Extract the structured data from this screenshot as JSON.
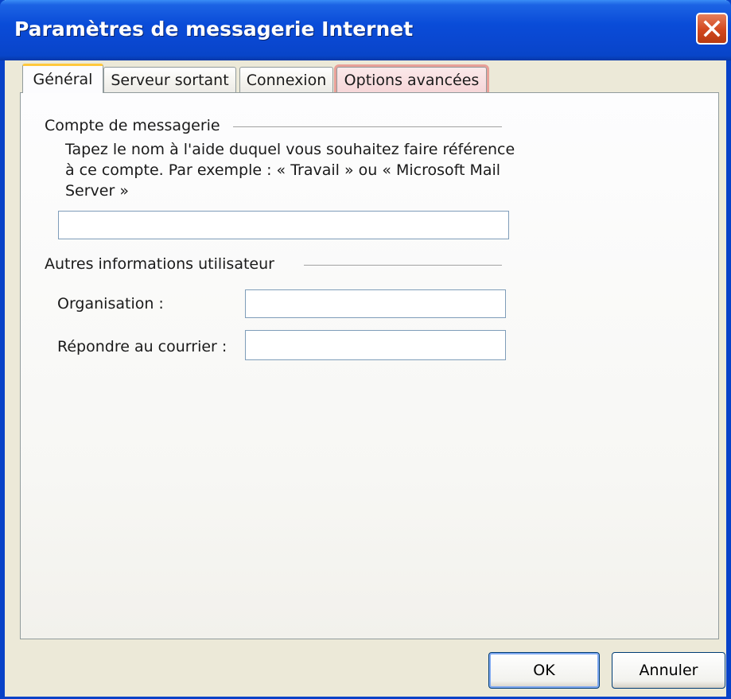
{
  "window": {
    "title": "Paramètres de messagerie Internet",
    "close_icon": "close-icon",
    "colors": {
      "titlebar": "#0A4CD8",
      "close_button": "#D2471E",
      "tab_highlight": "#E66464",
      "active_tab_accent": "#FFC83C"
    }
  },
  "tabs": [
    {
      "label": "Général",
      "active": true
    },
    {
      "label": "Serveur sortant",
      "active": false
    },
    {
      "label": "Connexion",
      "active": false
    },
    {
      "label": "Options avancées",
      "active": false,
      "highlighted": true
    }
  ],
  "general": {
    "account_group": {
      "label": "Compte de messagerie",
      "description": "Tapez le nom à l'aide duquel vous souhaitez faire référence à ce compte. Par exemple : « Travail » ou « Microsoft Mail Server »",
      "account_name_value": ""
    },
    "user_info_group": {
      "label": "Autres informations utilisateur",
      "organization_label": "Organisation :",
      "organization_value": "",
      "reply_label": "Répondre au courrier :",
      "reply_value": ""
    }
  },
  "buttons": {
    "ok": "OK",
    "cancel": "Annuler"
  }
}
